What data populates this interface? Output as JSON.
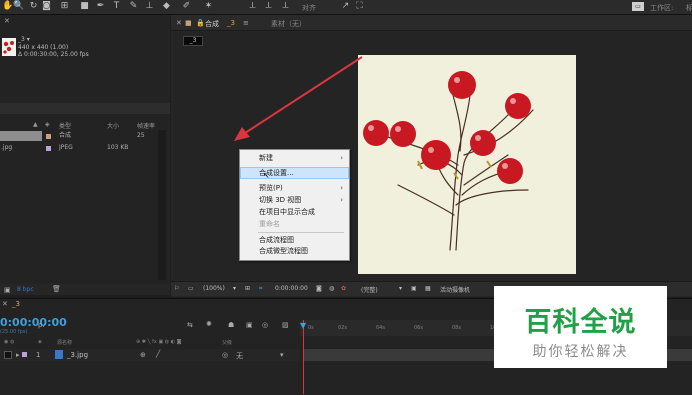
{
  "toolbar": {
    "align_label": "对齐",
    "workspace_label": "工作区:",
    "workspace_value": "标"
  },
  "project": {
    "item_name": "_3 ▾",
    "item_dimensions": "440 x 440 (1.00)",
    "item_duration": "Δ 0:00:30:00, 25.00 fps",
    "search_placeholder": "ρ▾",
    "headers": {
      "type": "类型",
      "size": "大小",
      "fps": "帧速率"
    },
    "rows": [
      {
        "name": "",
        "type": "合成",
        "size": "",
        "fps": "25",
        "selected": true,
        "swatch": "#c9a27a"
      },
      {
        "name": ".jpg",
        "type": "JPEG",
        "size": "103 KB",
        "fps": "",
        "selected": false,
        "swatch": "#b6a6d8"
      }
    ],
    "footer_bpc": "8 bpc"
  },
  "comp_tabs": {
    "comp_tab_prefix": "合成",
    "comp_tab_name": "_3",
    "footage_tab": "素材（无）",
    "comp_chip": "_3"
  },
  "viewer_footer": {
    "zoom": "(100%)",
    "timecode": "0:00:00:00",
    "resolution": "(完整)",
    "camera": "活动摄像机"
  },
  "context_menu": {
    "items": [
      {
        "label": "新建",
        "submenu": true,
        "highlighted": false,
        "disabled": false
      },
      {
        "label": "合成设置...",
        "submenu": false,
        "highlighted": true,
        "disabled": false
      },
      {
        "label": "预览(P)",
        "submenu": true,
        "highlighted": false,
        "disabled": false
      },
      {
        "label": "切换 3D 视图",
        "submenu": true,
        "highlighted": false,
        "disabled": false
      },
      {
        "label": "在项目中显示合成",
        "submenu": false,
        "highlighted": false,
        "disabled": false
      },
      {
        "label": "重命名",
        "submenu": false,
        "highlighted": false,
        "disabled": true
      },
      {
        "label": "合成流程图",
        "submenu": false,
        "highlighted": false,
        "disabled": false
      },
      {
        "label": "合成微型流程图",
        "submenu": false,
        "highlighted": false,
        "disabled": false
      }
    ]
  },
  "timeline": {
    "panel_name": "_3",
    "current_time": "0:00:00:00",
    "fps_label": "(25.00 fps)",
    "search_placeholder": "ρ.",
    "ruler_ticks": [
      "0s",
      "02s",
      "04s",
      "06s",
      "08s",
      "10s"
    ],
    "layer_header": "源名称",
    "switch_header": "父级",
    "layer": {
      "index": "1",
      "name": "_3.jpg",
      "parent": "无"
    }
  },
  "watermark": {
    "main": "百科全说",
    "sub": "助你轻松解决"
  },
  "colors": {
    "accent_blue": "#3aa0e0",
    "menu_highlight": "#cde5fa",
    "arrow_red": "#d9363e",
    "watermark_green": "#21a048"
  }
}
